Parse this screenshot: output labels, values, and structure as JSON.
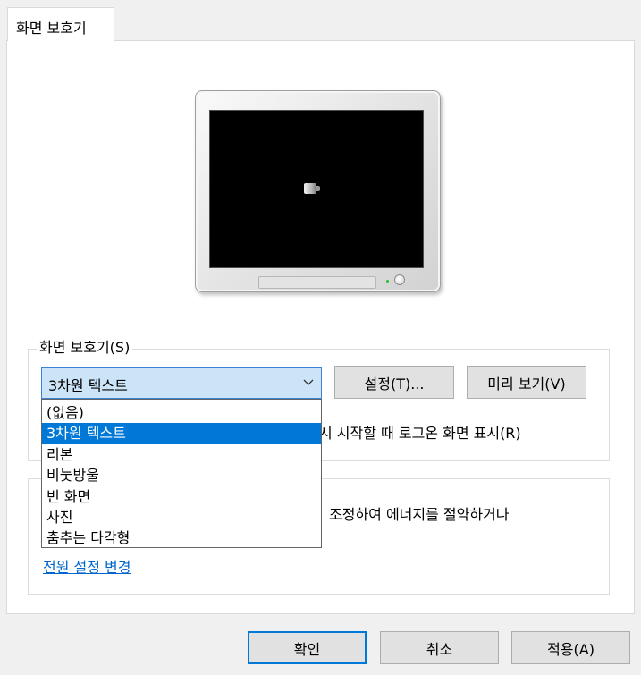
{
  "tab": {
    "label": "화면 보호기"
  },
  "screensaver_group": {
    "legend": "화면 보호기(S)",
    "selected": "3차원 텍스트",
    "settings_button": "설정(T)...",
    "preview_button": "미리 보기(V)",
    "options": [
      "(없음)",
      "3차원 텍스트",
      "리본",
      "비눗방울",
      "빈 화면",
      "사진",
      "춤추는 다각형"
    ],
    "resume_text_partial": "시 시작할 때 로그온 화면 표시(R)"
  },
  "power_group": {
    "text_partial": "조정하여 에너지를 절약하거나",
    "link": "전원 설정 변경"
  },
  "footer": {
    "ok": "확인",
    "cancel": "취소",
    "apply": "적용(A)"
  }
}
